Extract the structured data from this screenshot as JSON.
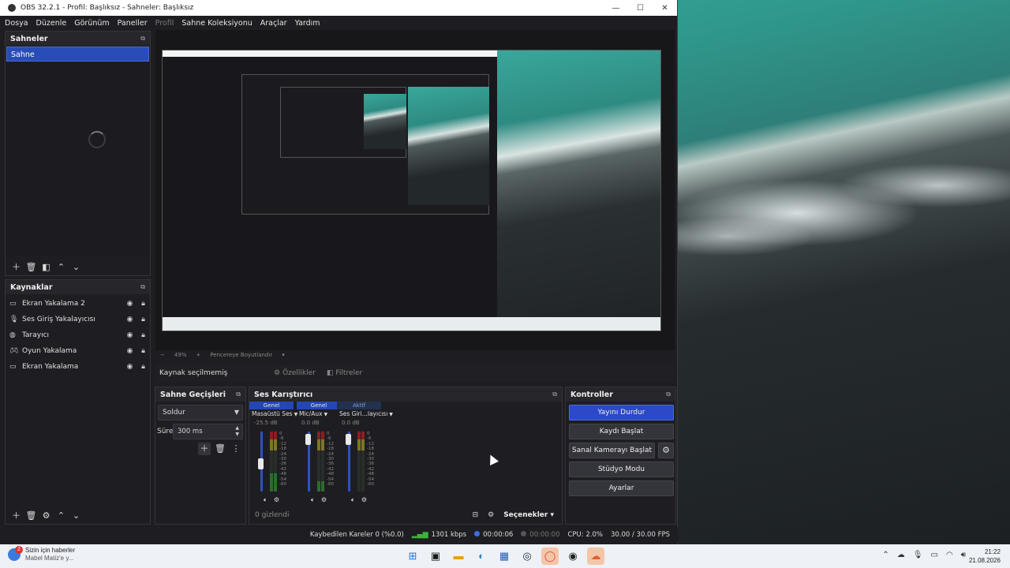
{
  "window": {
    "title": "OBS 32.2.1 - Profil: Başlıksız - Sahneler: Başlıksız",
    "minimize": "—",
    "maximize": "☐",
    "close": "✕"
  },
  "menu": [
    "Dosya",
    "Düzenle",
    "Görünüm",
    "Paneller",
    "Profil",
    "Sahne Koleksiyonu",
    "Araçlar",
    "Yardım"
  ],
  "scenes": {
    "title": "Sahneler",
    "items": [
      "Sahne"
    ]
  },
  "sources": {
    "title": "Kaynaklar",
    "items": [
      {
        "label": "Ekran Yakalama 2",
        "icon": "monitor-icon"
      },
      {
        "label": "Ses Giriş Yakalayıcısı",
        "icon": "microphone-icon"
      },
      {
        "label": "Tarayıcı",
        "icon": "globe-icon"
      },
      {
        "label": "Oyun Yakalama",
        "icon": "gamepad-icon"
      },
      {
        "label": "Ekran Yakalama",
        "icon": "monitor-icon"
      }
    ]
  },
  "preview_status": {
    "zoom": "49%",
    "fit": "Pencereye Boyutlandır"
  },
  "context": {
    "no_source": "Kaynak seçilmemiş",
    "properties": "Özellikler",
    "filters": "Filtreler"
  },
  "transitions": {
    "title": "Sahne Geçişleri",
    "selected": "Soldur",
    "duration_label": "Süre",
    "duration_value": "300 ms"
  },
  "mixer": {
    "title": "Ses Karıştırıcı",
    "channels": [
      {
        "tag": "Genel",
        "name": "Masaüstü Ses",
        "db": "-25.5 dB",
        "level": 0.45,
        "fader": 0.45
      },
      {
        "tag": "Genel",
        "name": "Mic/Aux",
        "db": "0.0 dB",
        "level": 0.25,
        "fader": 0.95
      },
      {
        "tag": "Aktif",
        "name": "Ses Giri...layıcısı",
        "db": "0.0 dB",
        "level": 0.0,
        "fader": 0.95
      }
    ],
    "scale": [
      "0",
      "-6",
      "-12",
      "-18",
      "-24",
      "-30",
      "-36",
      "-42",
      "-48",
      "-54",
      "-60"
    ],
    "hidden": "0 gizlendi",
    "options": "Seçenekler"
  },
  "controls": {
    "title": "Kontroller",
    "stop_stream": "Yayını Durdur",
    "start_record": "Kaydı Başlat",
    "virtual_cam": "Sanal Kamerayı Başlat",
    "studio_mode": "Stüdyo Modu",
    "settings": "Ayarlar"
  },
  "status": {
    "dropped": "Kaybedilen Kareler 0 (%0.0)",
    "bitrate": "1301 kbps",
    "stream_time": "00:00:06",
    "rec_time": "00:00:00",
    "cpu": "CPU: 2.0%",
    "fps": "30.00 / 30.00 FPS"
  },
  "taskbar": {
    "news_title": "Sizin için haberler",
    "news_sub": "Mabel Matiz'e y...",
    "news_badge": "2",
    "time": "21:22",
    "date": "21.08.2026"
  },
  "colors": {
    "accent": "#2b49c8",
    "selected": "#284cb8"
  }
}
